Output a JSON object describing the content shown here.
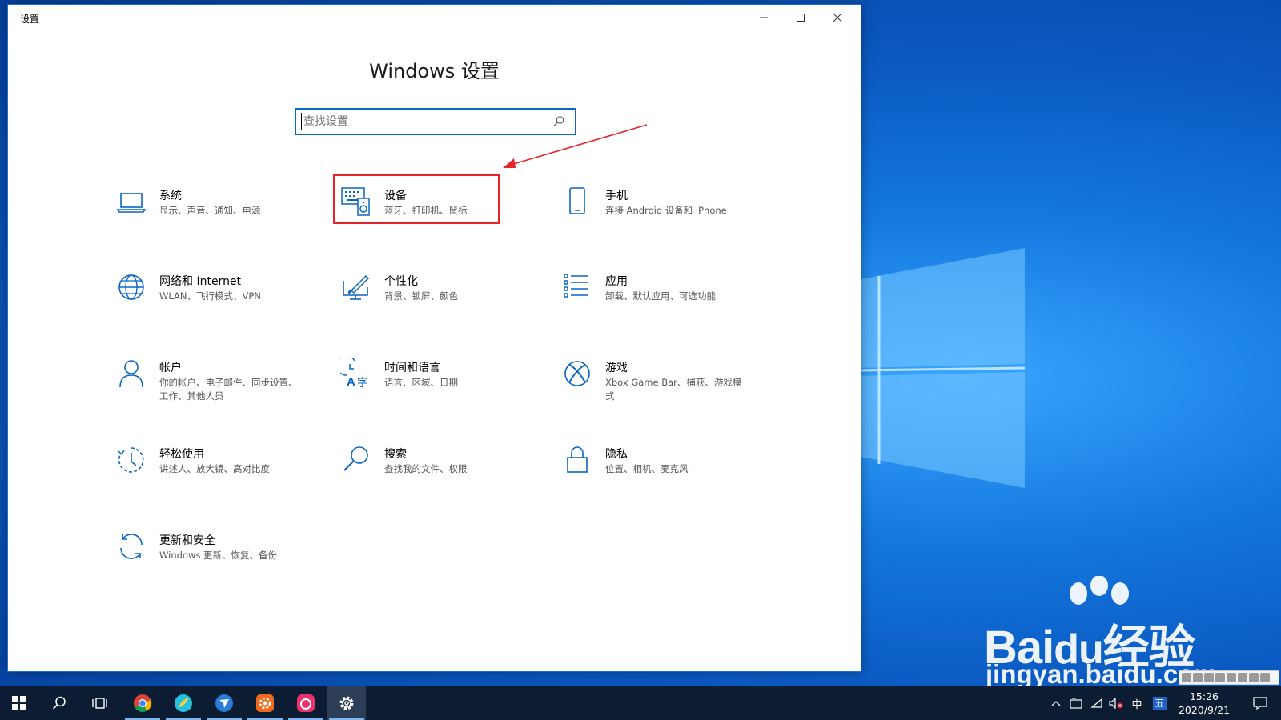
{
  "window": {
    "title": "设置"
  },
  "page": {
    "title": "Windows 设置"
  },
  "search": {
    "placeholder": "查找设置"
  },
  "tiles": [
    {
      "title": "系统",
      "desc": "显示、声音、通知、电源"
    },
    {
      "title": "设备",
      "desc": "蓝牙、打印机、鼠标"
    },
    {
      "title": "手机",
      "desc": "连接 Android 设备和 iPhone"
    },
    {
      "title": "网络和 Internet",
      "desc": "WLAN、飞行模式、VPN"
    },
    {
      "title": "个性化",
      "desc": "背景、锁屏、颜色"
    },
    {
      "title": "应用",
      "desc": "卸载、默认应用、可选功能"
    },
    {
      "title": "帐户",
      "desc": "你的帐户、电子邮件、同步设置、工作、其他人员"
    },
    {
      "title": "时间和语言",
      "desc": "语言、区域、日期"
    },
    {
      "title": "游戏",
      "desc": "Xbox Game Bar、捕获、游戏模式"
    },
    {
      "title": "轻松使用",
      "desc": "讲述人、放大镜、高对比度"
    },
    {
      "title": "搜索",
      "desc": "查找我的文件、权限"
    },
    {
      "title": "隐私",
      "desc": "位置、相机、麦克风"
    },
    {
      "title": "更新和安全",
      "desc": "Windows 更新、恢复、备份"
    }
  ],
  "taskbar": {
    "tray": {
      "ime_lang": "中",
      "ime_mode": "五"
    },
    "clock": {
      "time": "15:26",
      "date": "2020/9/21"
    }
  },
  "watermark": {
    "brand": "Bai",
    "brand_cn": "经验",
    "url": "jingyan.baidu.com"
  },
  "colors": {
    "accent": "#0a66c2",
    "highlight": "#e3242b",
    "taskbar": "#0c1d33"
  }
}
